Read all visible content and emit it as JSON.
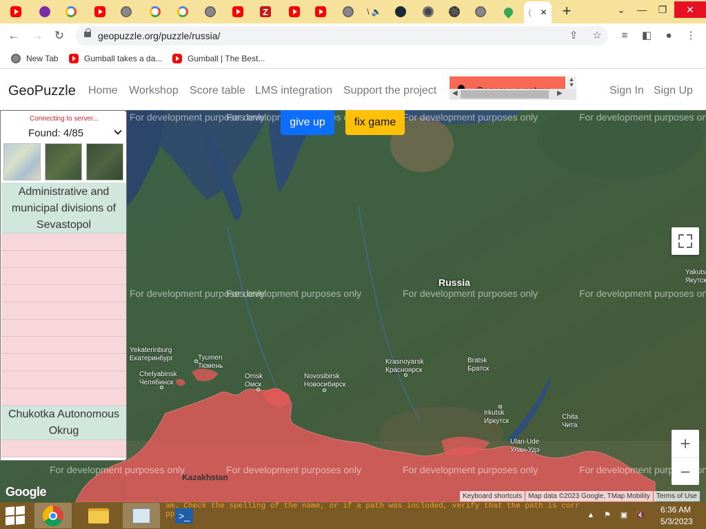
{
  "browser": {
    "tab_count_icons": [
      "youtube",
      "purple",
      "google",
      "youtube",
      "globe",
      "google",
      "google",
      "globe",
      "youtube",
      "zotero",
      "youtube",
      "youtube",
      "globe",
      "audio",
      "steam",
      "chrome",
      "gear",
      "globe",
      "maps"
    ],
    "active_tab_close": "✕",
    "new_tab": "+",
    "url": "geopuzzle.org/puzzle/russia/",
    "bookmarks": [
      {
        "label": "New Tab",
        "icon": "globe-icon"
      },
      {
        "label": "Gumball takes a da...",
        "icon": "youtube-icon"
      },
      {
        "label": "Gumball | The Best...",
        "icon": "youtube-icon"
      }
    ]
  },
  "site": {
    "brand": "GeoPuzzle",
    "nav": [
      "Home",
      "Workshop",
      "Score table",
      "LMS integration",
      "Support the project"
    ],
    "ad_text": "Become a patron",
    "sign_in": "Sign In",
    "sign_up": "Sign Up"
  },
  "game": {
    "give_up": "give up",
    "fix_game": "fix game",
    "status": "Connecting to server...",
    "found": "Found: 4/85",
    "found_items": [
      "Administrative and municipal divisions of Sevastopol",
      "Chukotka Autonomous Okrug"
    ]
  },
  "map": {
    "watermark": "For development purposes only",
    "country_label": "Russia",
    "neighbor_label": "Kazakhstan",
    "cities": [
      {
        "name": "Yekaterinburg",
        "native": "Екатеринбург"
      },
      {
        "name": "Tyumen",
        "native": "Тюмень"
      },
      {
        "name": "Chelyabinsk",
        "native": "Челябинск"
      },
      {
        "name": "Omsk",
        "native": "Омск"
      },
      {
        "name": "Novosibirsk",
        "native": "Новосибирск"
      },
      {
        "name": "Krasnoyarsk",
        "native": "Красноярск"
      },
      {
        "name": "Bratsk",
        "native": "Братск"
      },
      {
        "name": "Irkutsk",
        "native": "Иркутск"
      },
      {
        "name": "Chita",
        "native": "Чита"
      },
      {
        "name": "Ulan-Ude",
        "native": "Улан-Удэ"
      },
      {
        "name": "Yakutsk",
        "native": "Якутск"
      }
    ],
    "zoom_in": "+",
    "zoom_out": "−",
    "google": "Google",
    "attribution": [
      "Keyboard shortcuts",
      "Map data ©2023 Google, TMap Mobility",
      "Terms of Use"
    ]
  },
  "taskbar": {
    "console_line1": "am. Check the spelling of the name, or if a path was included, verify that the path is correct and",
    "console_line2": "ppel",
    "time": "6:36 AM",
    "date": "5/3/2023"
  },
  "colors": {
    "tabstrip": "#f6e29a",
    "primary_button": "#0d6efd",
    "warning_button": "#ffc107",
    "found_row": "#d1e7dd",
    "pending_row": "#f8d7da",
    "region_fill": "#e05a5a"
  }
}
